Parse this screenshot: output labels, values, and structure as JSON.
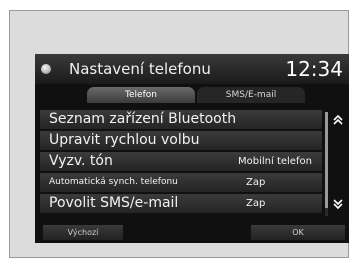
{
  "header": {
    "title": "Nastavení telefonu",
    "clock": "12:34"
  },
  "tabs": [
    {
      "label": "Telefon",
      "active": true
    },
    {
      "label": "SMS/E-mail",
      "active": false
    }
  ],
  "menu": [
    {
      "label": "Seznam zařízení Bluetooth",
      "value": ""
    },
    {
      "label": "Upravit rychlou volbu",
      "value": ""
    },
    {
      "label": "Vyzv. tón",
      "value": "Mobilní telefon"
    },
    {
      "label": "Automatická synch. telefonu",
      "value": "Zap"
    },
    {
      "label": "Povolit SMS/e-mail",
      "value": "Zap"
    }
  ],
  "scroll": {
    "up_icon": "double-chevron-up",
    "down_icon": "double-chevron-down"
  },
  "footer": {
    "default_label": "Výchozí",
    "ok_label": "OK"
  }
}
